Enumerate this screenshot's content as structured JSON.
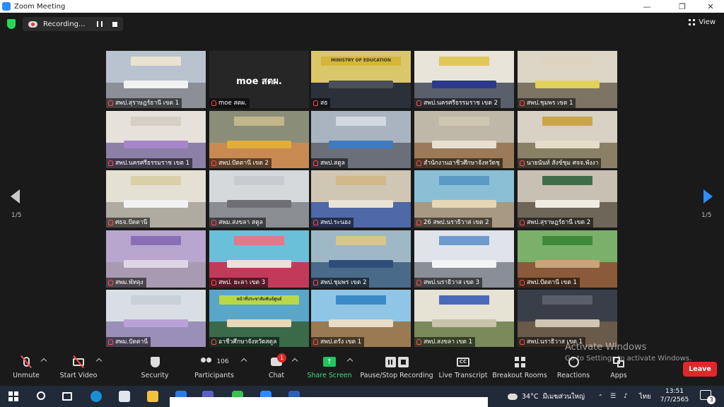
{
  "window": {
    "title": "Zoom Meeting"
  },
  "recording": {
    "label": "Recording..."
  },
  "view": {
    "label": "View"
  },
  "gallery": {
    "page_left": "1/5",
    "page_right": "1/5",
    "tiles": [
      {
        "label": "สพป.สุราษฎร์ธานี เขต 1",
        "wall": "#b9c2cf",
        "floor": "#8c8f96",
        "table": "#f1f1f1",
        "banner": "#e8e2d0",
        "state": ""
      },
      {
        "label": "moe สตผ.",
        "center": "moe สตผ.",
        "state": "moe"
      },
      {
        "label": "สธ",
        "banner_text": "MINISTRY OF EDUCATION",
        "wall": "#d9c76a",
        "floor": "#2c3038",
        "table": "#4a4f5a",
        "banner": "#d4b63a",
        "state": "active"
      },
      {
        "label": "สพป.นครศรีธรรมราช เขต 2",
        "wall": "#e8e4da",
        "floor": "#5a5f6c",
        "table": "#2b3a8c",
        "banner": "#e0c85a",
        "state": ""
      },
      {
        "label": "สพป.ชุมพร เขต 1",
        "wall": "#dcd4c4",
        "floor": "#7d7464",
        "table": "#e2d15a",
        "banner": "#ddd3bf",
        "state": ""
      },
      {
        "label": "สพป.นครศรีธรรมราช เขต 1",
        "wall": "#e6e1da",
        "floor": "#8c7fa8",
        "table": "#a686c9",
        "banner": "#d6cfc4",
        "state": ""
      },
      {
        "label": "สพป.ปัตตานี เขต 2",
        "wall": "#8a8e78",
        "floor": "#c98a52",
        "table": "#e2ad3a",
        "banner": "#c2b78a",
        "state": "speaking"
      },
      {
        "label": "สพป.สตูล",
        "wall": "#a9b4c0",
        "floor": "#6a6f7a",
        "table": "#3c7cc2",
        "banner": "#d2d8e0",
        "state": ""
      },
      {
        "label": "สำนักงานอาชีวศึกษาจังหวัดชุ",
        "wall": "#bfb8a8",
        "floor": "#9a7a58",
        "table": "#e6e0d2",
        "banner": "#cfc6b2",
        "state": ""
      },
      {
        "label": "นายนันท์ สังข์ชุม ศจจ.พังงา",
        "wall": "#d8d2c4",
        "floor": "#8a8066",
        "table": "#e6ddc8",
        "banner": "#caa54a",
        "state": ""
      },
      {
        "label": "ศธจ.ปัตตานี",
        "wall": "#e4e0d4",
        "floor": "#b0aba0",
        "table": "#f2f2f2",
        "banner": "#d9cfa8",
        "state": ""
      },
      {
        "label": "สพม.สงขลา สตูล",
        "wall": "#d6d9dc",
        "floor": "#8a8d92",
        "table": "#6e6f74",
        "banner": "#c8cbd0",
        "state": ""
      },
      {
        "label": "สพป.ระนอง",
        "wall": "#cfc7b4",
        "floor": "#4f68a8",
        "table": "#e8e3d6",
        "banner": "#d0b88a",
        "state": ""
      },
      {
        "label": "26 สพป.นราธิวาส เขต 2",
        "wall": "#8bbfd6",
        "floor": "#a89a82",
        "table": "#e6d8b6",
        "banner": "#5a9ac4",
        "state": ""
      },
      {
        "label": "สพป.สุราษฎร์ธานี เขต 2",
        "wall": "#c8c0b2",
        "floor": "#6e6658",
        "table": "#f0ece2",
        "banner": "#3f6d4a",
        "state": ""
      },
      {
        "label": "สพม.พัทลุง",
        "wall": "#b8a6cf",
        "floor": "#a89ab0",
        "table": "#ddd6e6",
        "banner": "#8a6fb6",
        "state": ""
      },
      {
        "label": "สพป. ยะลา เขต 3",
        "wall": "#6ac0d8",
        "floor": "#c23a5a",
        "table": "#e8e2da",
        "banner": "#e07a8a",
        "state": ""
      },
      {
        "label": "สพป.ชุมพร เขต 2",
        "wall": "#9fb8c8",
        "floor": "#4a6a8a",
        "table": "#2e4e7a",
        "banner": "#d7c78a",
        "state": ""
      },
      {
        "label": "สพป.นราธิวาส เขต 3",
        "wall": "#e0e4ea",
        "floor": "#8a8e96",
        "table": "#f4f4f4",
        "banner": "#6f9ad0",
        "state": ""
      },
      {
        "label": "สพป.ปัตตานี เขต 1",
        "wall": "#7ab06a",
        "floor": "#8a5a3a",
        "table": "#c8a47a",
        "banner": "#3f8a3a",
        "state": ""
      },
      {
        "label": "สพม.ปัตตานี",
        "wall": "#d8dee4",
        "floor": "#9a8fb8",
        "table": "#b8a2d6",
        "banner": "#c8d0d8",
        "state": ""
      },
      {
        "label": "อาชีวศึกษาจังหวัดสตูล",
        "banner_text": "หน้าที่ประชาสัมพันธ์ศูนย์",
        "wall": "#5aa6c8",
        "floor": "#3a6a4a",
        "table": "#e8d8b8",
        "banner": "#b8d84a",
        "state": ""
      },
      {
        "label": "สพป.ตรัง เขต 1",
        "wall": "#8fc6e6",
        "floor": "#9a7a52",
        "table": "#e8ddc8",
        "banner": "#3a8ac8",
        "state": ""
      },
      {
        "label": "สพป.สงขลา เขต 1",
        "wall": "#e6e2d4",
        "floor": "#7a8a5a",
        "table": "#c8c2aa",
        "banner": "#4a6ab8",
        "state": ""
      },
      {
        "label": "สพป.นราธิวาส เขต 1",
        "wall": "#3a3e48",
        "floor": "#6a5a4a",
        "table": "#cfc6b4",
        "banner": "#5a5e6a",
        "state": ""
      }
    ]
  },
  "toolbar": {
    "unmute": "Unmute",
    "start_video": "Start Video",
    "security": "Security",
    "participants": "Participants",
    "participants_count": "106",
    "chat": "Chat",
    "chat_badge": "1",
    "share_screen": "Share Screen",
    "recording": "Pause/Stop Recording",
    "live_transcript": "Live Transcript",
    "cc_icon": "CC",
    "breakout_rooms": "Breakout Rooms",
    "reactions": "Reactions",
    "apps": "Apps",
    "leave": "Leave"
  },
  "watermark": {
    "line1": "Activate Windows",
    "line2": "Go to Settings to activate Windows."
  },
  "taskbar": {
    "temperature": "34°C",
    "weather": "มีเมฆส่วนใหญ่",
    "language": "ไทย",
    "time": "13:51",
    "date": "7/7/2565",
    "notifications": "3"
  },
  "colors": {
    "accent": "#2d8cff",
    "leave": "#e02828",
    "share": "#23c45e",
    "active_speaker": "#f4e94a"
  }
}
